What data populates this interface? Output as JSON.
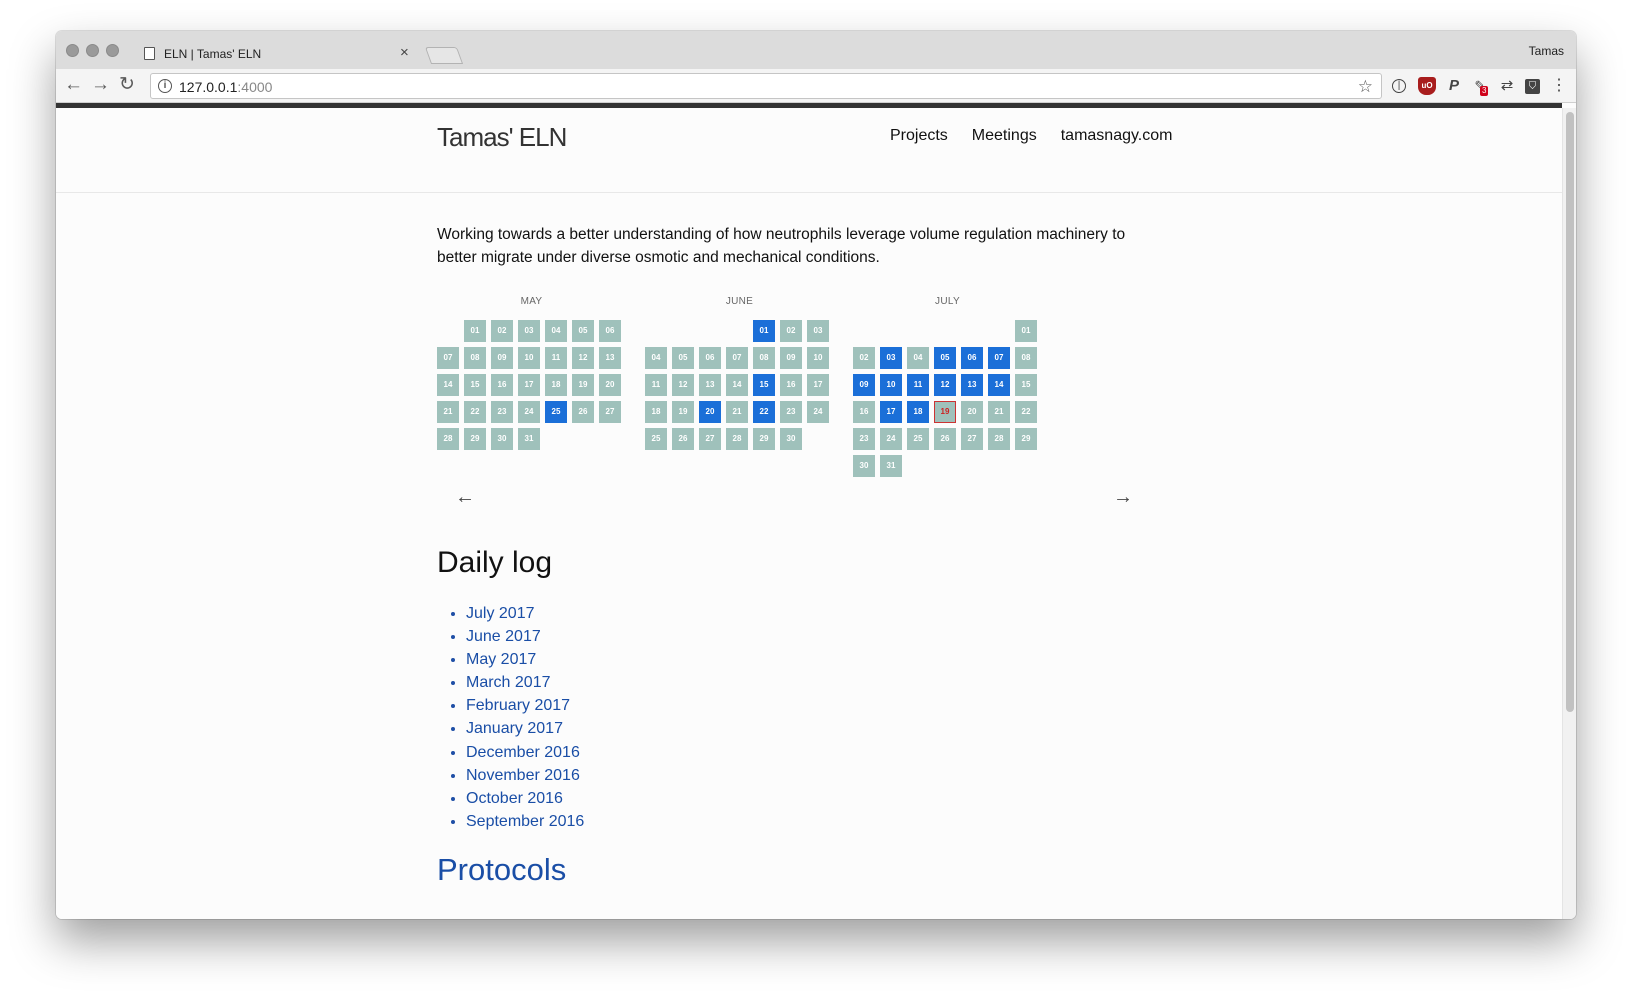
{
  "browser": {
    "tab_title": "ELN | Tamas' ELN",
    "tab_close": "×",
    "profile_name": "Tamas",
    "url_host": "127.0.0.1",
    "url_port": ":4000",
    "back_glyph": "←",
    "forward_glyph": "→",
    "reload_glyph": "↻",
    "star_glyph": "☆",
    "extension_badge": "3",
    "menu_glyph": "⋮"
  },
  "site": {
    "brand": "Tamas' ELN",
    "nav": [
      "Projects",
      "Meetings",
      "tamasnagy.com"
    ],
    "intro": "Working towards a better understanding of how neutrophils leverage volume regulation machinery to better migrate under diverse osmotic and mechanical conditions."
  },
  "calendar": {
    "months": [
      {
        "name": "MAY",
        "first_weekday": 1,
        "days": 31,
        "logged": [
          25
        ],
        "today": null
      },
      {
        "name": "JUNE",
        "first_weekday": 4,
        "days": 30,
        "logged": [
          1,
          15,
          20,
          22
        ],
        "today": null
      },
      {
        "name": "JULY",
        "first_weekday": 6,
        "days": 31,
        "logged": [
          3,
          5,
          6,
          7,
          9,
          10,
          11,
          12,
          13,
          14,
          17,
          18
        ],
        "today": 19
      }
    ],
    "prev_glyph": "←",
    "next_glyph": "→"
  },
  "daily_log": {
    "heading": "Daily log",
    "items": [
      "July 2017",
      "June 2017",
      "May 2017",
      "March 2017",
      "February 2017",
      "January 2017",
      "December 2016",
      "November 2016",
      "October 2016",
      "September 2016"
    ]
  },
  "protocols": {
    "heading": "Protocols"
  },
  "colors": {
    "day": "#9fc1bb",
    "logged": "#1b6fd8",
    "today_border": "#cc3333",
    "link": "#1a4ea6"
  }
}
